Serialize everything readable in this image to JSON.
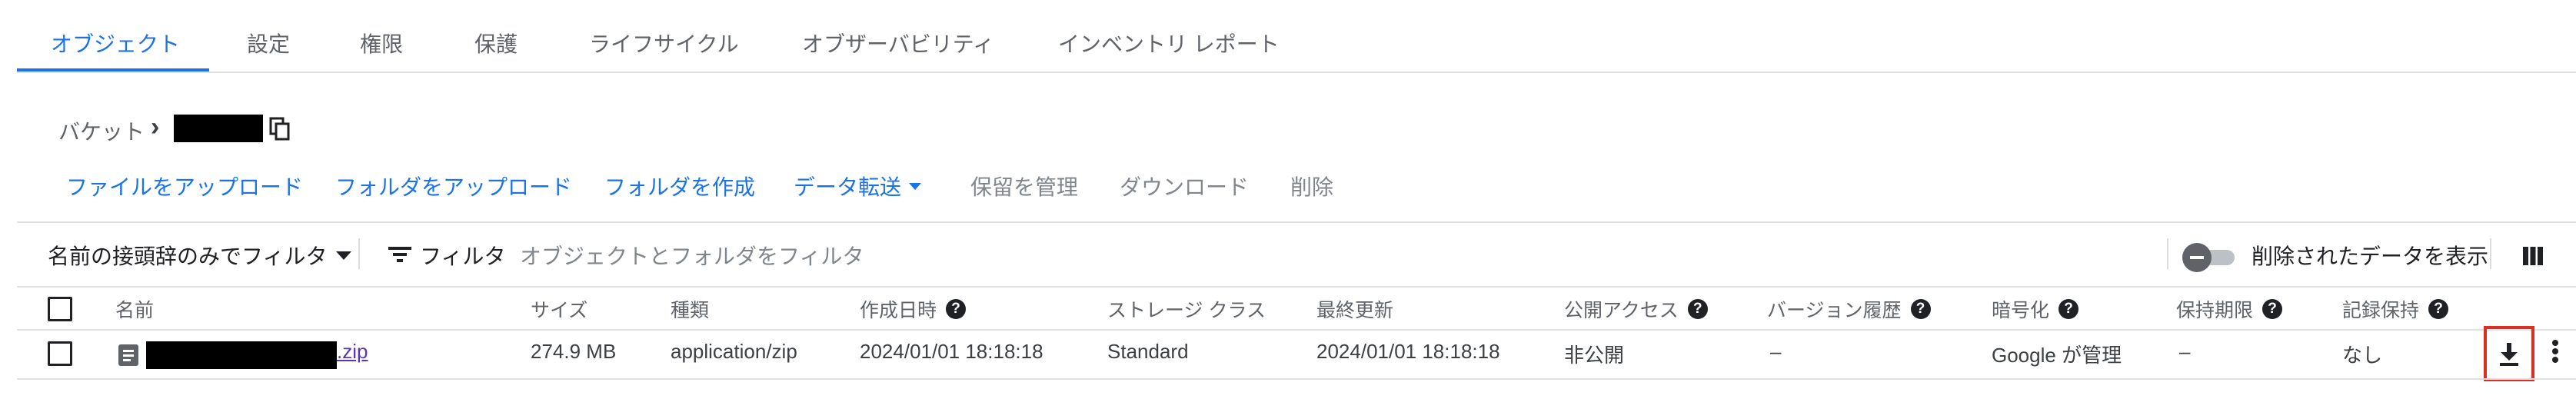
{
  "tabs": [
    {
      "label": "オブジェクト",
      "active": true
    },
    {
      "label": "設定"
    },
    {
      "label": "権限"
    },
    {
      "label": "保護"
    },
    {
      "label": "ライフサイクル"
    },
    {
      "label": "オブザーバビリティ"
    },
    {
      "label": "インベントリ レポート"
    }
  ],
  "breadcrumb": {
    "root": "バケット",
    "separator": "›"
  },
  "actions": {
    "upload_file": "ファイルをアップロード",
    "upload_folder": "フォルダをアップロード",
    "create_folder": "フォルダを作成",
    "data_transfer": "データ転送",
    "manage_holds": "保留を管理",
    "download": "ダウンロード",
    "delete": "削除"
  },
  "filter_bar": {
    "prefix_filter": "名前の接頭辞のみでフィルタ",
    "filter_label": "フィルタ",
    "filter_placeholder": "オブジェクトとフォルダをフィルタ",
    "show_deleted": "削除されたデータを表示"
  },
  "table": {
    "headers": {
      "name": "名前",
      "size": "サイズ",
      "type": "種類",
      "created": "作成日時",
      "storage_class": "ストレージ クラス",
      "updated": "最終更新",
      "public_access": "公開アクセス",
      "version_history": "バージョン履歴",
      "encryption": "暗号化",
      "retention_period": "保持期限",
      "record_retention": "記録保持"
    },
    "rows": [
      {
        "name_suffix": ".zip",
        "size": "274.9 MB",
        "type": "application/zip",
        "created": "2024/01/01 18:18:18",
        "storage_class": "Standard",
        "updated": "2024/01/01 18:18:18",
        "public_access": "非公開",
        "version_history": "–",
        "encryption": "Google が管理",
        "retention_period": "–",
        "record_retention": "なし"
      }
    ]
  },
  "colors": {
    "accent": "#1a73e8",
    "highlight_box": "#d93025"
  }
}
